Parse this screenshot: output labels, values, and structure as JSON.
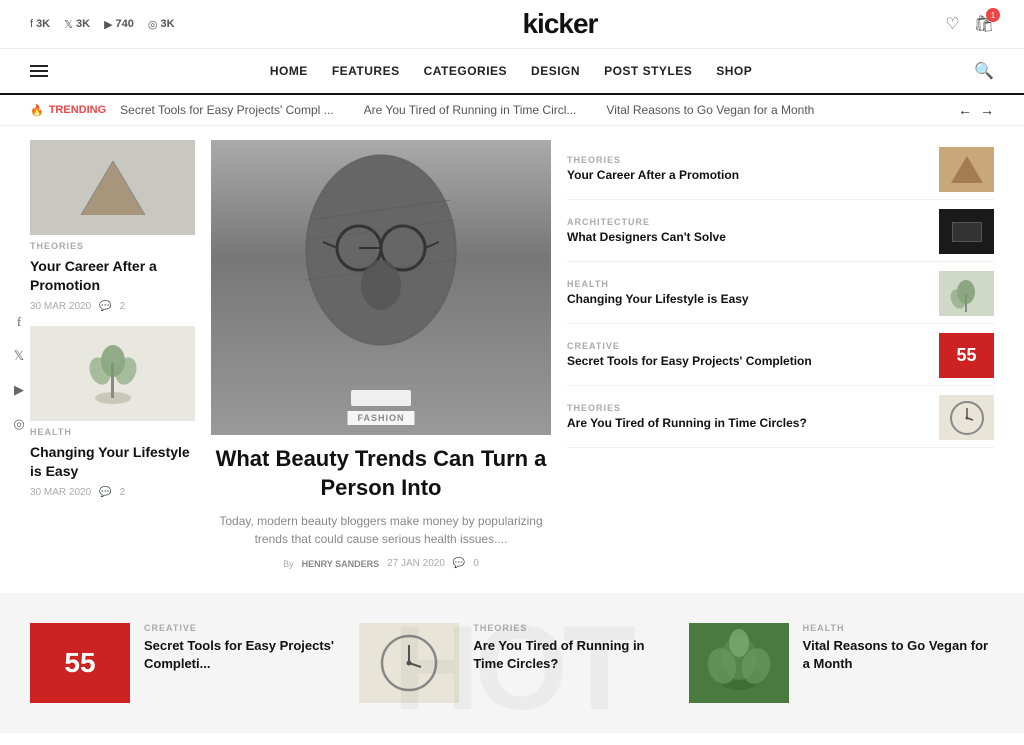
{
  "site": {
    "logo": "kicker"
  },
  "topbar": {
    "social": [
      {
        "icon": "f",
        "platform": "facebook",
        "count": "3K"
      },
      {
        "icon": "t",
        "platform": "twitter",
        "count": "3K"
      },
      {
        "icon": "▶",
        "platform": "youtube",
        "count": "740"
      },
      {
        "icon": "◎",
        "platform": "instagram",
        "count": "3K"
      }
    ],
    "cart_count": "1"
  },
  "nav": {
    "hamburger_label": "menu",
    "links": [
      "HOME",
      "FEATURES",
      "CATEGORIES",
      "DESIGN",
      "POST STYLES",
      "SHOP"
    ],
    "search_label": "search"
  },
  "ticker": {
    "trending_label": "TRENDING",
    "items": [
      "Secret Tools for Easy Projects' Compl ...",
      "Are You Tired of Running in Time Circl...",
      "Vital Reasons to Go Vegan for a Month"
    ],
    "prev": "←",
    "next": "→"
  },
  "left_col": {
    "cards": [
      {
        "category": "THEORIES",
        "title": "Your Career After a Promotion",
        "date": "30 MAR 2020",
        "comments": "2",
        "img_type": "triangle"
      },
      {
        "category": "HEALTH",
        "title": "Changing Your Lifestyle is Easy",
        "date": "30 MAR 2020",
        "comments": "2",
        "img_type": "plant"
      }
    ]
  },
  "featured": {
    "category": "FASHION",
    "title": "What Beauty Trends Can Turn a Person Into",
    "excerpt": "Today, modern beauty bloggers make money by popularizing trends that could cause serious health issues....",
    "author": "HENRY SANDERS",
    "date": "27 JAN 2020",
    "comments": "0",
    "img_type": "face"
  },
  "right_col": {
    "items": [
      {
        "category": "THEORIES",
        "title": "Your Career After a Promotion",
        "img_type": "wood"
      },
      {
        "category": "ARCHITECTURE",
        "title": "What Designers Can't Solve",
        "img_type": "dark"
      },
      {
        "category": "HEALTH",
        "title": "Changing Your Lifestyle is Easy",
        "img_type": "plant2"
      },
      {
        "category": "CREATIVE",
        "title": "Secret Tools for Easy Projects' Completion",
        "img_type": "red"
      },
      {
        "category": "THEORIES",
        "title": "Are You Tired of Running in Time Circles?",
        "img_type": "clock"
      }
    ]
  },
  "float_social": [
    {
      "icon": "f",
      "label": "facebook"
    },
    {
      "icon": "t",
      "label": "twitter"
    },
    {
      "icon": "▶",
      "label": "youtube"
    },
    {
      "icon": "◎",
      "label": "instagram"
    }
  ],
  "bottom_strip": {
    "bg_text": "HOT",
    "cards": [
      {
        "category": "CREATIVE",
        "title": "Secret Tools for Easy Projects' Completi...",
        "img_type": "red"
      },
      {
        "category": "THEORIES",
        "title": "Are You Tired of Running in Time Circles?",
        "img_type": "clock"
      },
      {
        "category": "HEALTH",
        "title": "Vital Reasons to Go Vegan for a Month",
        "img_type": "green"
      }
    ]
  }
}
